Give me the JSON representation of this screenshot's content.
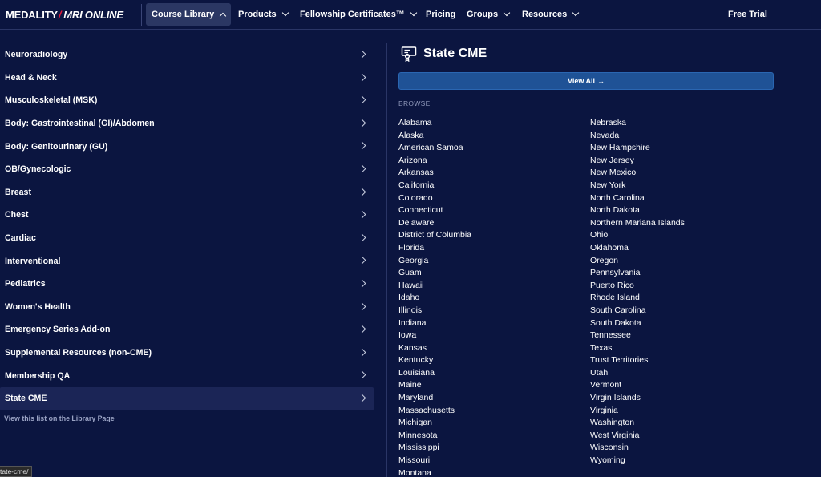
{
  "logo": {
    "brand": "MEDALITY",
    "separator": "/",
    "product": "MRI ONLINE"
  },
  "nav": {
    "items": [
      {
        "label": "Course Library",
        "state": "open"
      },
      {
        "label": "Products"
      },
      {
        "label": "Fellowship Certificates™"
      },
      {
        "label": "Pricing"
      },
      {
        "label": "Groups"
      },
      {
        "label": "Resources"
      }
    ],
    "free_trial": "Free Trial"
  },
  "sidebar": {
    "items": [
      {
        "label": "Neuroradiology"
      },
      {
        "label": "Head & Neck"
      },
      {
        "label": "Musculoskeletal (MSK)"
      },
      {
        "label": "Body: Gastrointestinal (GI)/Abdomen"
      },
      {
        "label": "Body: Genitourinary (GU)"
      },
      {
        "label": "OB/Gynecologic"
      },
      {
        "label": "Breast"
      },
      {
        "label": "Chest"
      },
      {
        "label": "Cardiac"
      },
      {
        "label": "Interventional"
      },
      {
        "label": "Pediatrics"
      },
      {
        "label": "Women's Health"
      },
      {
        "label": "Emergency Series Add-on"
      },
      {
        "label": "Supplemental Resources (non-CME)"
      },
      {
        "label": "Membership QA"
      },
      {
        "label": "State CME",
        "active": true
      }
    ],
    "library_link": "View this list on the Library Page"
  },
  "content": {
    "title": "State CME",
    "title_icon": "certificate-icon",
    "view_all": "View All",
    "view_all_arrow": "→",
    "browse_label": "BROWSE",
    "states_col1": [
      "Alabama",
      "Alaska",
      "American Samoa",
      "Arizona",
      "Arkansas",
      "California",
      "Colorado",
      "Connecticut",
      "Delaware",
      "District of Columbia",
      "Florida",
      "Georgia",
      "Guam",
      "Hawaii",
      "Idaho",
      "Illinois",
      "Indiana",
      "Iowa",
      "Kansas",
      "Kentucky",
      "Louisiana",
      "Maine",
      "Maryland",
      "Massachusetts",
      "Michigan",
      "Minnesota",
      "Mississippi",
      "Missouri",
      "Montana"
    ],
    "states_col2": [
      "Nebraska",
      "Nevada",
      "New Hampshire",
      "New Jersey",
      "New Mexico",
      "New York",
      "North Carolina",
      "North Dakota",
      "Northern Mariana Islands",
      "Ohio",
      "Oklahoma",
      "Oregon",
      "Pennsylvania",
      "Puerto Rico",
      "Rhode Island",
      "South Carolina",
      "South Dakota",
      "Tennessee",
      "Texas",
      "Trust Territories",
      "Utah",
      "Vermont",
      "Virgin Islands",
      "Virginia",
      "Washington",
      "West Virginia",
      "Wisconsin",
      "Wyoming"
    ]
  },
  "status_bar": "tate-cme/",
  "colors": {
    "background": "#0b1540",
    "accent_red": "#e8173a",
    "button_blue": "#1f5296",
    "active_row": "#1b2556"
  }
}
